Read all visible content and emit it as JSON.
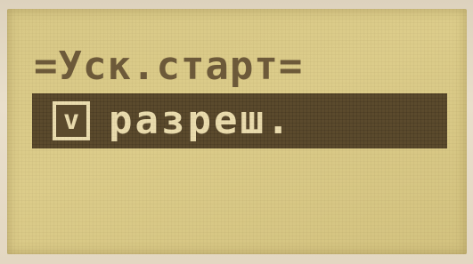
{
  "menu": {
    "title": "=Уск.старт=",
    "option": {
      "checkbox_glyph": "v",
      "value": "разреш."
    }
  }
}
